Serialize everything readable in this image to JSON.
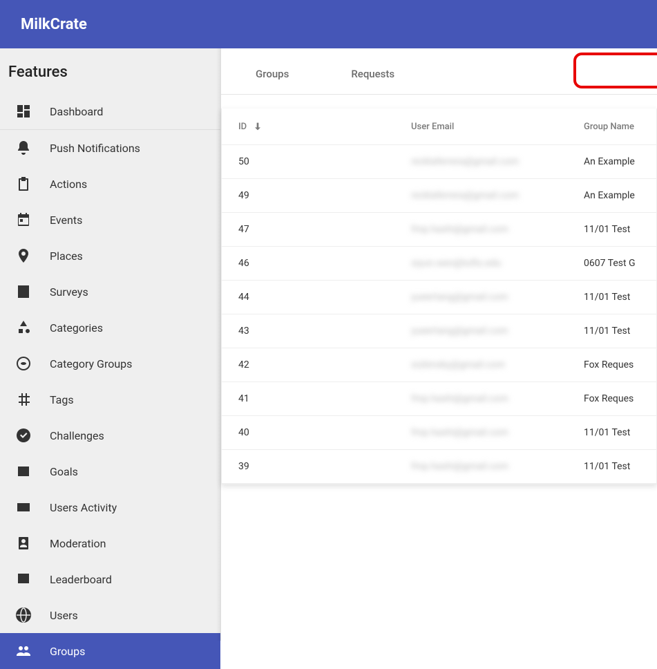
{
  "app": {
    "brand": "MilkCrate"
  },
  "sidebar": {
    "heading": "Features",
    "items": [
      {
        "label": "Dashboard",
        "icon": "dashboard"
      },
      {
        "label": "Push Notifications",
        "icon": "bell"
      },
      {
        "label": "Actions",
        "icon": "clipboard"
      },
      {
        "label": "Events",
        "icon": "calendar"
      },
      {
        "label": "Places",
        "icon": "place"
      },
      {
        "label": "Surveys",
        "icon": "survey"
      },
      {
        "label": "Categories",
        "icon": "shapes"
      },
      {
        "label": "Category Groups",
        "icon": "sphere"
      },
      {
        "label": "Tags",
        "icon": "hash"
      },
      {
        "label": "Challenges",
        "icon": "check-circle"
      },
      {
        "label": "Goals",
        "icon": "meter"
      },
      {
        "label": "Users Activity",
        "icon": "rect"
      },
      {
        "label": "Moderation",
        "icon": "badge"
      },
      {
        "label": "Leaderboard",
        "icon": "leaderboard"
      },
      {
        "label": "Users",
        "icon": "globe"
      },
      {
        "label": "Groups",
        "icon": "groups",
        "active": true
      }
    ]
  },
  "tabs": {
    "groups": "Groups",
    "requests": "Requests",
    "active": "requests",
    "highlighted": "requests"
  },
  "table": {
    "columns": {
      "id": "ID",
      "email": "User Email",
      "group": "Group Name"
    },
    "sort": {
      "column": "id",
      "direction": "desc"
    },
    "rows": [
      {
        "id": "50",
        "email": "nicklaferrera@gmail.com",
        "group": "An Example"
      },
      {
        "id": "49",
        "email": "nicklaferrera@gmail.com",
        "group": "An Example"
      },
      {
        "id": "47",
        "email": "fmp.hashi@gmail.com",
        "group": "11/01 Test"
      },
      {
        "id": "46",
        "email": "siyun.wen@tufts.edu",
        "group": "0607 Test G"
      },
      {
        "id": "44",
        "email": "yueertang@gmail.com",
        "group": "11/01 Test"
      },
      {
        "id": "43",
        "email": "yueertang@gmail.com",
        "group": "11/01 Test"
      },
      {
        "id": "42",
        "email": "sizbinsky@gmail.com",
        "group": "Fox Reques"
      },
      {
        "id": "41",
        "email": "fmp.hashi@gmail.com",
        "group": "Fox Reques"
      },
      {
        "id": "40",
        "email": "fmp.hashi@gmail.com",
        "group": "11/01 Test"
      },
      {
        "id": "39",
        "email": "fmp.hashi@gmail.com",
        "group": "11/01 Test"
      }
    ]
  }
}
